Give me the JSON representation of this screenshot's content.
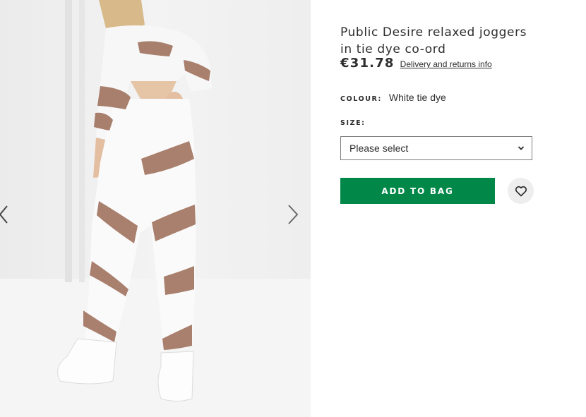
{
  "product": {
    "title": "Public Desire relaxed joggers in tie dye co-ord",
    "price": "€31.78",
    "delivery_link": "Delivery and returns info"
  },
  "colour": {
    "label": "COLOUR:",
    "value": "White tie dye"
  },
  "size": {
    "label": "SIZE:",
    "selected": "Please select"
  },
  "actions": {
    "add_to_bag": "ADD TO BAG"
  },
  "gallery": {
    "prev_icon": "chevron-left-icon",
    "next_icon": "chevron-right-icon"
  },
  "colors": {
    "accent": "#018849",
    "text": "#2d2d2d",
    "gallery_bg": "#eeeeee",
    "tie_dye": "#9b6a55"
  }
}
